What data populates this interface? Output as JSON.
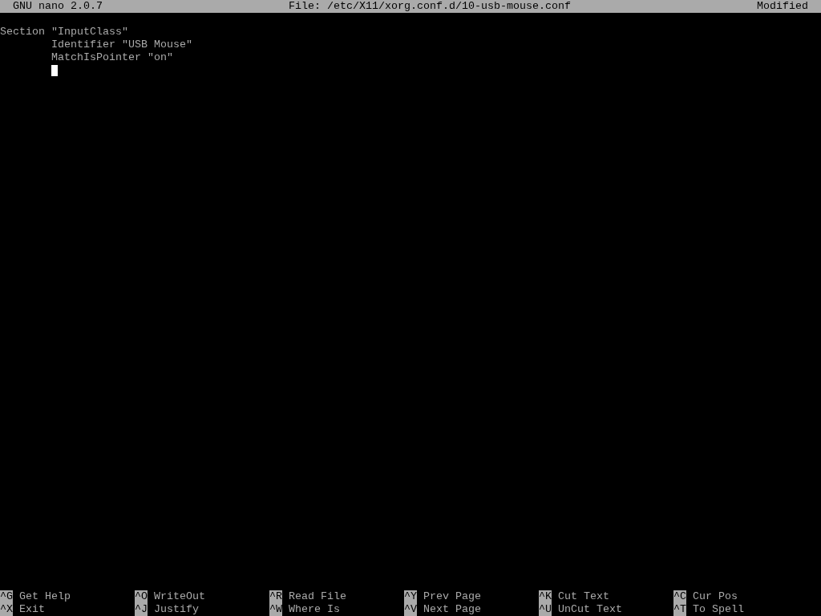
{
  "title_bar": {
    "app": "GNU nano 2.0.7",
    "file": "File: /etc/X11/xorg.conf.d/10-usb-mouse.conf",
    "status": "Modified"
  },
  "editor": {
    "lines": [
      "Section \"InputClass\"",
      "\tIdentifier \"USB Mouse\"",
      "\tMatchIsPointer \"on\""
    ],
    "cursor": {
      "shown": true
    }
  },
  "shortcuts": [
    {
      "key": "^G",
      "label": "Get Help"
    },
    {
      "key": "^O",
      "label": "WriteOut"
    },
    {
      "key": "^R",
      "label": "Read File"
    },
    {
      "key": "^Y",
      "label": "Prev Page"
    },
    {
      "key": "^K",
      "label": "Cut Text"
    },
    {
      "key": "^C",
      "label": "Cur Pos"
    },
    {
      "key": "^X",
      "label": "Exit"
    },
    {
      "key": "^J",
      "label": "Justify"
    },
    {
      "key": "^W",
      "label": "Where Is"
    },
    {
      "key": "^V",
      "label": "Next Page"
    },
    {
      "key": "^U",
      "label": "UnCut Text"
    },
    {
      "key": "^T",
      "label": "To Spell"
    }
  ]
}
